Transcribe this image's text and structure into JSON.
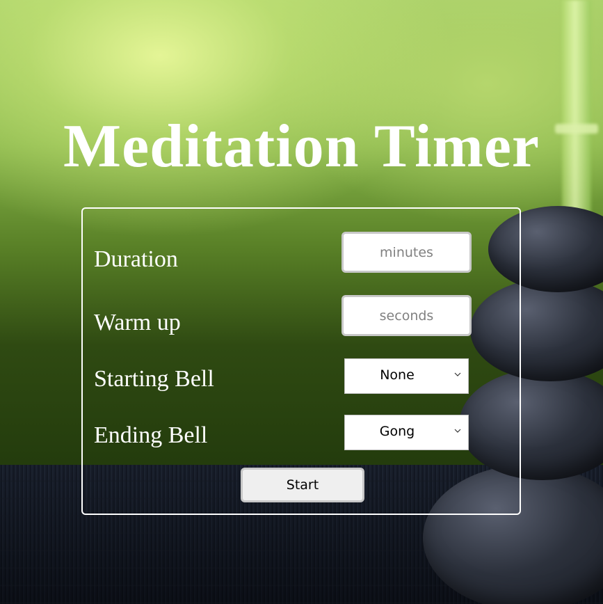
{
  "title": "Meditation Timer",
  "form": {
    "duration": {
      "label": "Duration",
      "placeholder": "minutes"
    },
    "warmup": {
      "label": "Warm up",
      "placeholder": "seconds"
    },
    "starting_bell": {
      "label": "Starting Bell",
      "selected": "None"
    },
    "ending_bell": {
      "label": "Ending Bell",
      "selected": "Gong"
    },
    "start_label": "Start"
  },
  "icons": {
    "dropdown": "chevron-down-icon"
  }
}
